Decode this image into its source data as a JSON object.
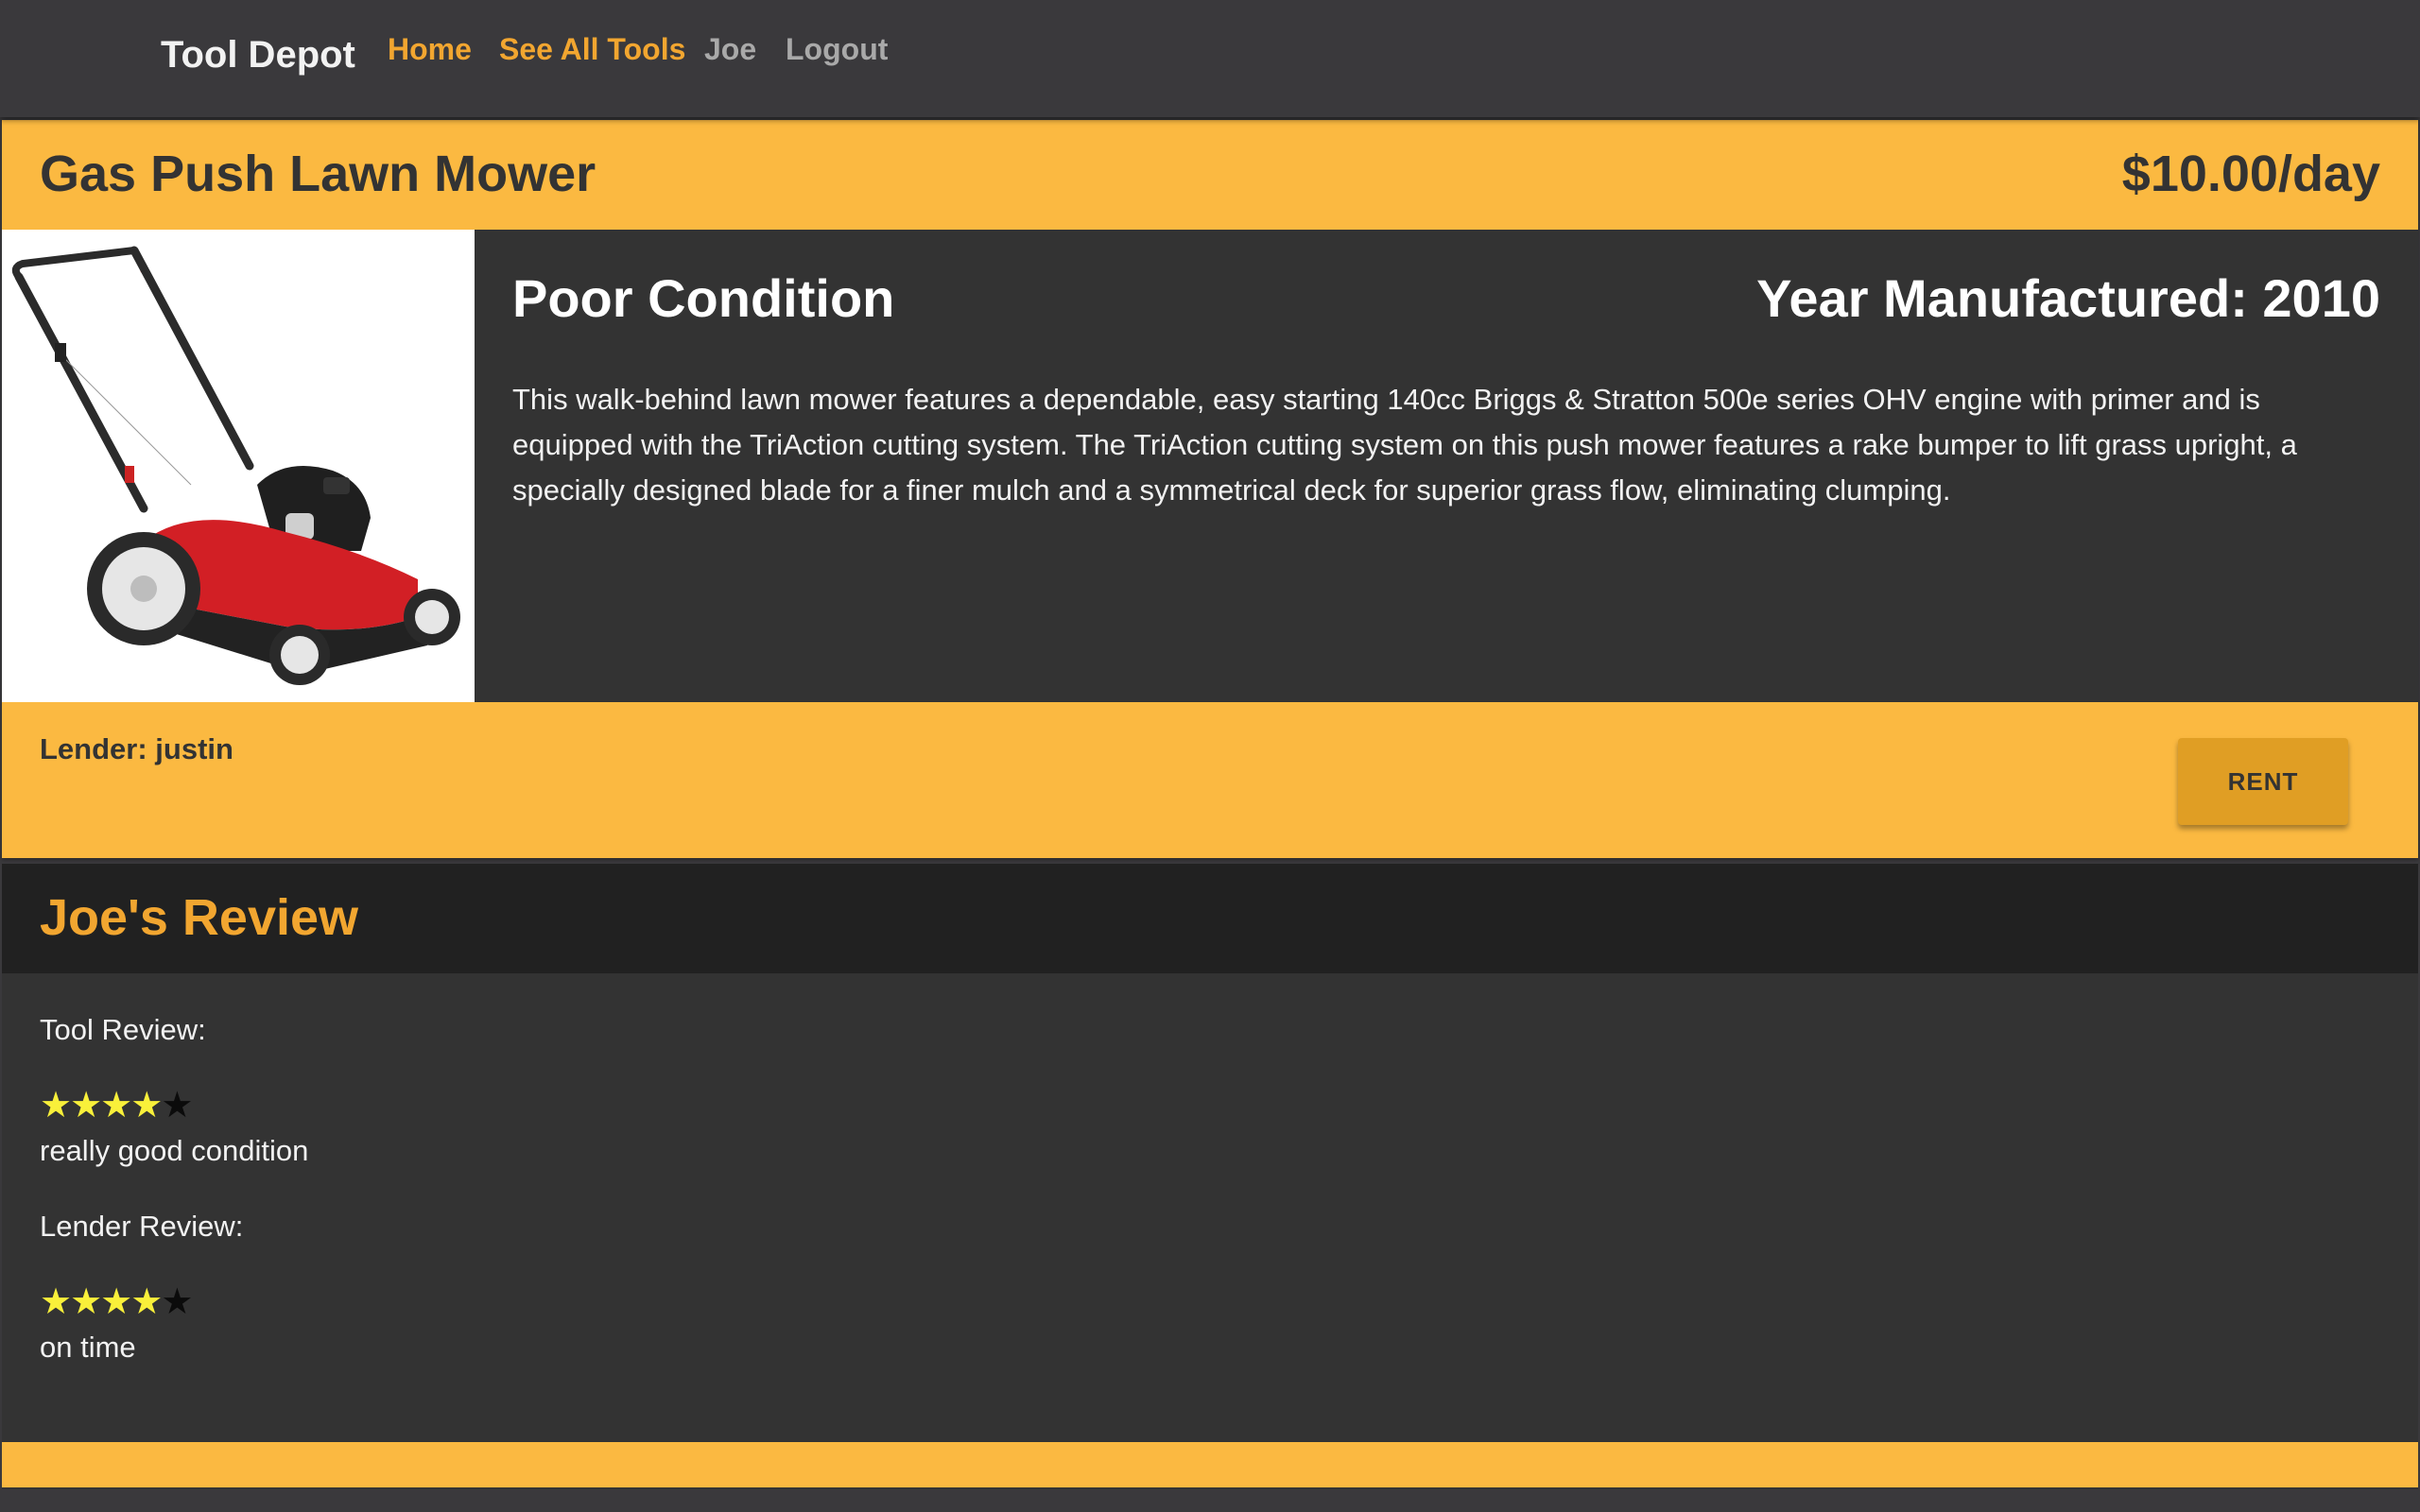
{
  "navbar": {
    "brand": "Tool Depot",
    "links": {
      "home": "Home",
      "see_all_tools": "See All Tools",
      "user": "Joe",
      "logout": "Logout"
    }
  },
  "tool": {
    "name": "Gas Push Lawn Mower",
    "price": "$10.00/day",
    "condition": "Poor Condition",
    "year_manufactured": "Year Manufactured: 2010",
    "description": "This walk-behind lawn mower features a dependable, easy starting 140cc Briggs & Stratton 500e series OHV engine with primer and is equipped with the TriAction cutting system. The TriAction cutting system on this push mower features a rake bumper to lift grass upright, a specially designed blade for a finer mulch and a symmetrical deck for superior grass flow, eliminating clumping.",
    "lender": "Lender: justin",
    "rent_label": "RENT",
    "image_icon": "lawn-mower-photo"
  },
  "review": {
    "title": "Joe's Review",
    "tool_review_label": "Tool Review:",
    "tool_rating": 4,
    "tool_rating_max": 5,
    "tool_review_text": "really good condition",
    "lender_review_label": "Lender Review:",
    "lender_rating": 4,
    "lender_rating_max": 5,
    "lender_review_text": "on time"
  },
  "colors": {
    "accent": "#fbb941",
    "link_active": "#f2a630",
    "dark_panel": "#333333",
    "navbar": "#3a393c",
    "star_filled": "#f9f03a"
  }
}
